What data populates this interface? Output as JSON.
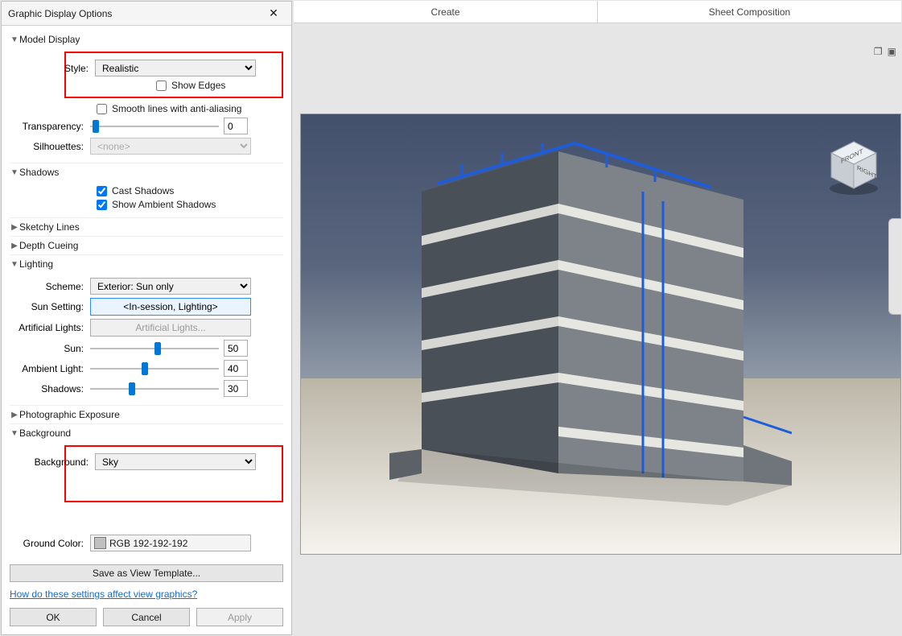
{
  "dialog": {
    "title": "Graphic Display Options",
    "close_tooltip": "Close",
    "sections": {
      "model_display": {
        "header": "Model Display",
        "expanded": true,
        "style_label": "Style:",
        "style_value": "Realistic",
        "show_edges_label": "Show Edges",
        "show_edges_checked": false,
        "smooth_lines_label": "Smooth lines with anti-aliasing",
        "smooth_lines_checked": false,
        "transparency_label": "Transparency:",
        "transparency_value": "0",
        "transparency_slider_pct": 2,
        "silhouettes_label": "Silhouettes:",
        "silhouettes_value": "<none>"
      },
      "shadows": {
        "header": "Shadows",
        "expanded": true,
        "cast_label": "Cast Shadows",
        "cast_checked": true,
        "ambient_label": "Show Ambient Shadows",
        "ambient_checked": true
      },
      "sketchy": {
        "header": "Sketchy Lines",
        "expanded": false
      },
      "depth": {
        "header": "Depth Cueing",
        "expanded": false
      },
      "lighting": {
        "header": "Lighting",
        "expanded": true,
        "scheme_label": "Scheme:",
        "scheme_value": "Exterior: Sun only",
        "sun_setting_label": "Sun Setting:",
        "sun_setting_value": "<In-session, Lighting>",
        "artificial_label": "Artificial Lights:",
        "artificial_button": "Artificial Lights...",
        "sun_label": "Sun:",
        "sun_value": "50",
        "sun_pct": 50,
        "ambient_label": "Ambient Light:",
        "ambient_value": "40",
        "ambient_pct": 40,
        "shadows_label": "Shadows:",
        "shadows_value": "30",
        "shadows_pct": 30
      },
      "photo": {
        "header": "Photographic Exposure",
        "expanded": false
      },
      "background": {
        "header": "Background",
        "expanded": true,
        "background_label": "Background:",
        "background_value": "Sky",
        "ground_color_label": "Ground Color:",
        "ground_color_value": "RGB 192-192-192"
      }
    },
    "save_template": "Save as View Template...",
    "help_link": "How do these settings affect view graphics?",
    "ok": "OK",
    "cancel": "Cancel",
    "apply": "Apply"
  },
  "tabs": {
    "create": "Create",
    "sheet_composition": "Sheet Composition"
  },
  "viewcube": {
    "front": "FRONT",
    "right": "RIGHT"
  }
}
